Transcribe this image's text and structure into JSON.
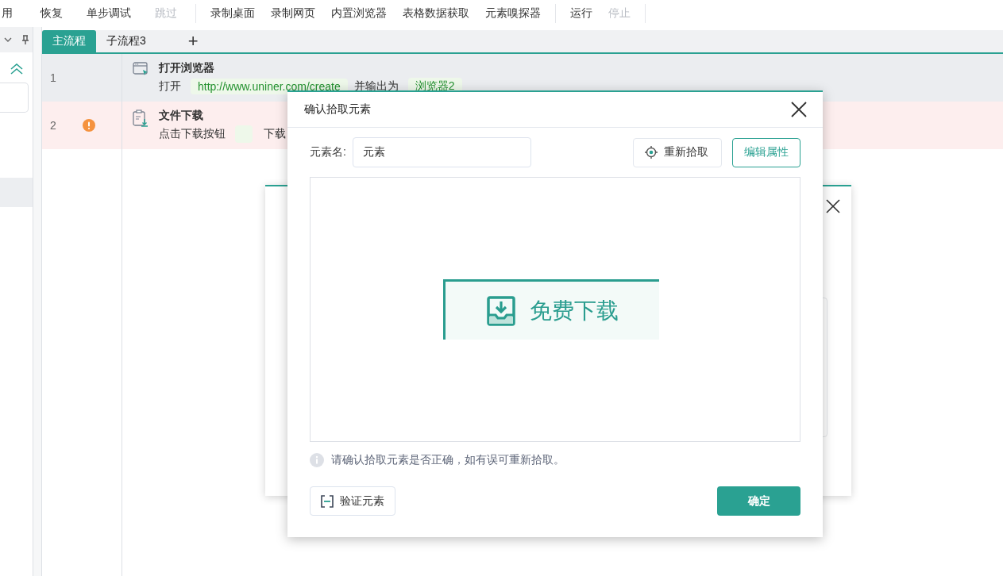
{
  "toolbar": {
    "groups": [
      [
        {
          "label": "用",
          "disabled": false
        },
        {
          "label": "恢复",
          "disabled": false
        },
        {
          "label": "单步调试",
          "disabled": false
        },
        {
          "label": "跳过",
          "disabled": true
        }
      ],
      [
        {
          "label": "录制桌面",
          "disabled": false
        },
        {
          "label": "录制网页",
          "disabled": false
        },
        {
          "label": "内置浏览器",
          "disabled": false
        },
        {
          "label": "表格数据获取",
          "disabled": false
        },
        {
          "label": "元素嗅探器",
          "disabled": false
        }
      ],
      [
        {
          "label": "运行",
          "disabled": false
        },
        {
          "label": "停止",
          "disabled": true
        }
      ]
    ]
  },
  "tabs": [
    {
      "label": "主流程",
      "selected": true
    },
    {
      "label": "子流程3",
      "selected": false
    }
  ],
  "add_tab": "+",
  "steps": [
    {
      "number": "1",
      "kind": "browser",
      "title": "打开浏览器",
      "selected": true,
      "error": false,
      "parts": [
        {
          "kind": "text",
          "text": "打开"
        },
        {
          "kind": "chip",
          "text": "http://www.uniner.com/create"
        },
        {
          "kind": "text",
          "text": "并输出为"
        },
        {
          "kind": "chip",
          "text": "浏览器2"
        }
      ]
    },
    {
      "number": "2",
      "kind": "download",
      "title": "文件下载",
      "selected": false,
      "error": true,
      "parts": [
        {
          "kind": "text",
          "text": "点击下载按钮"
        },
        {
          "kind": "chip"
        },
        {
          "kind": "text",
          "text": "下载"
        }
      ]
    }
  ],
  "dialog": {
    "title": "确认拾取元素",
    "name_label": "元素名:",
    "name_value": "元素",
    "repick_button": "重新拾取",
    "edit_button": "编辑属性",
    "preview": {
      "label": "免费下载"
    },
    "hint": "请确认拾取元素是否正确，如有误可重新拾取。",
    "verify_button": "验证元素",
    "ok_button": "确定"
  }
}
